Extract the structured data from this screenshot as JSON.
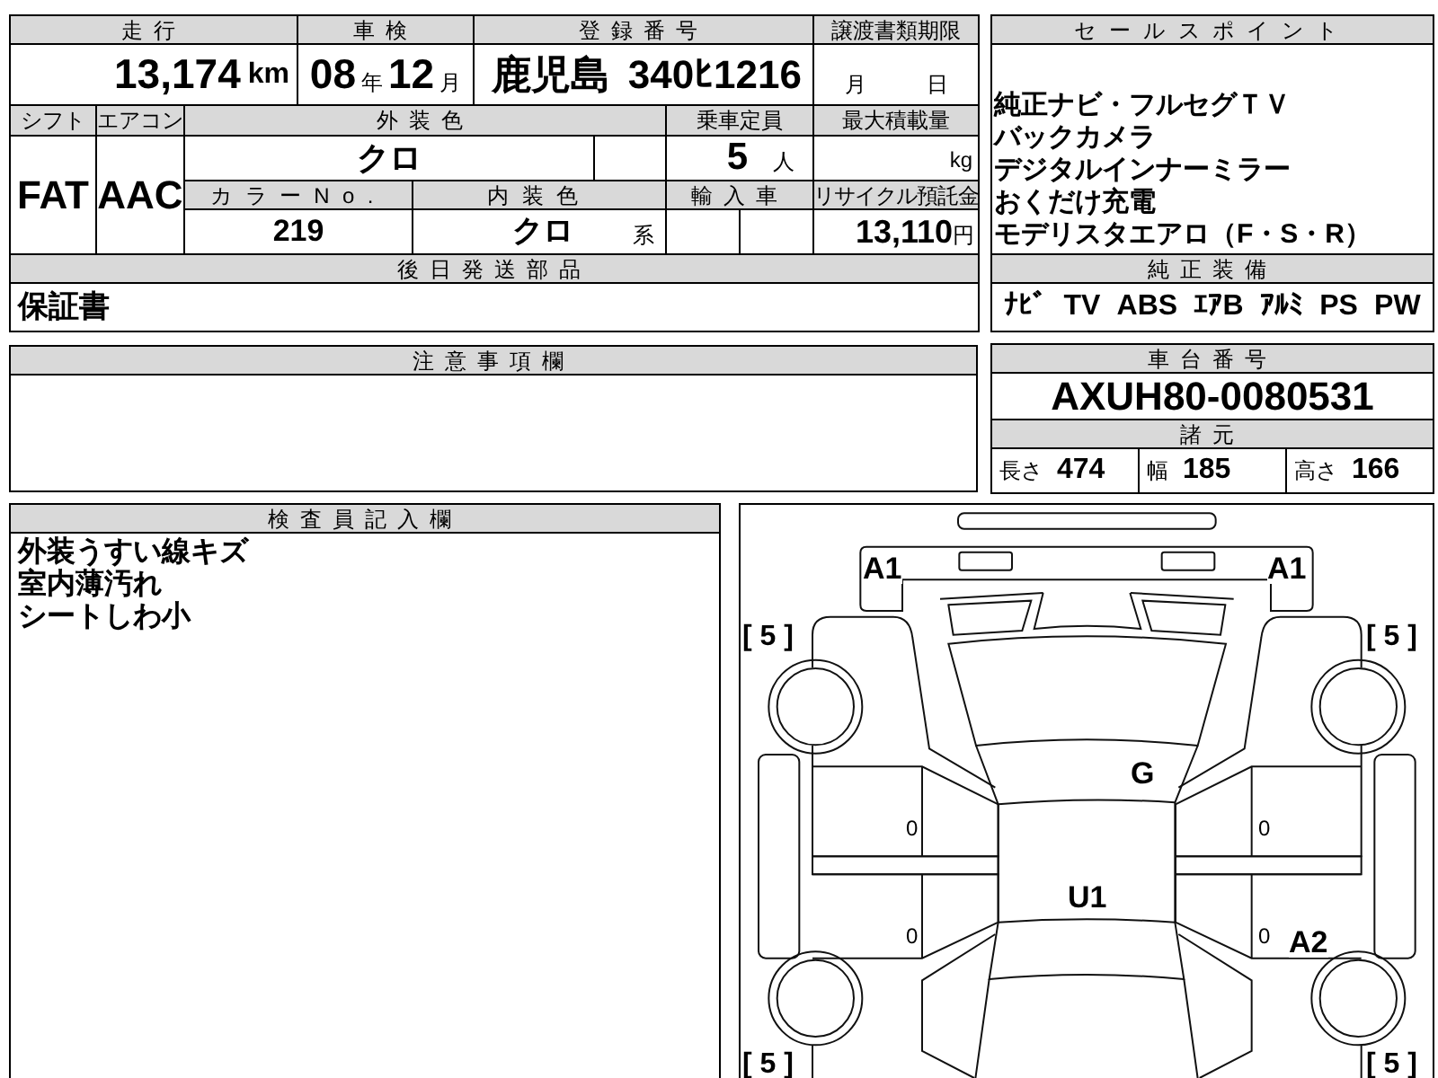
{
  "vehicle_table": {
    "mileage": {
      "label": "走行",
      "value": "13,174",
      "unit": "km"
    },
    "inspection": {
      "label": "車検",
      "year": "08",
      "year_unit": "年",
      "month": "12",
      "month_unit": "月"
    },
    "registration": {
      "label": "登録番号",
      "region": "鹿児島",
      "number": "340ﾋ1216"
    },
    "transfer_deadline": {
      "label": "譲渡書類期限",
      "month_unit": "月",
      "day_unit": "日"
    },
    "shift": {
      "label": "シフト",
      "value": "FAT"
    },
    "aircon": {
      "label": "エアコン",
      "value": "AAC"
    },
    "exterior_color": {
      "label": "外装色",
      "value": "クロ"
    },
    "capacity": {
      "label": "乗車定員",
      "value": "5",
      "unit": "人"
    },
    "max_load": {
      "label": "最大積載量",
      "unit": "kg"
    },
    "color_no": {
      "label": "カラーNo.",
      "value": "219"
    },
    "interior_color": {
      "label": "内装色",
      "value": "クロ",
      "suffix": "系"
    },
    "import": {
      "label": "輸入車"
    },
    "recycle_fee": {
      "label": "リサイクル預託金",
      "value": "13,110",
      "unit": "円"
    },
    "later_parts": {
      "label": "後日発送部品",
      "value": "保証書"
    }
  },
  "notes": {
    "label": "注意事項欄"
  },
  "sale_points": {
    "label": "セールスポイント",
    "lines": [
      "純正ナビ・フルセグＴＶ",
      "バックカメラ",
      "デジタルインナーミラー",
      "おくだけ充電",
      "モデリスタエアロ（F・S・R）"
    ]
  },
  "equipment": {
    "label": "純正装備",
    "items": [
      "ﾅﾋﾞ",
      "TV",
      "ABS",
      "ｴｱB",
      "ｱﾙﾐ",
      "PS",
      "PW"
    ]
  },
  "chassis": {
    "label": "車台番号",
    "value": "AXUH80-0080531"
  },
  "specs": {
    "label": "諸元",
    "items": [
      {
        "label": "長さ",
        "value": "474"
      },
      {
        "label": "幅",
        "value": "185"
      },
      {
        "label": "高さ",
        "value": "166"
      }
    ]
  },
  "inspector": {
    "label": "検査員記入欄",
    "lines": [
      "外装うすい線キズ",
      "室内薄汚れ",
      "シートしわ小"
    ]
  },
  "diagram": {
    "marks": [
      "A1",
      "A1",
      "[ 5 ]",
      "[ 5 ]",
      "[ 5 ]",
      "[ 5 ]",
      "G",
      "U1",
      "A2",
      "0",
      "0",
      "0",
      "0"
    ]
  }
}
